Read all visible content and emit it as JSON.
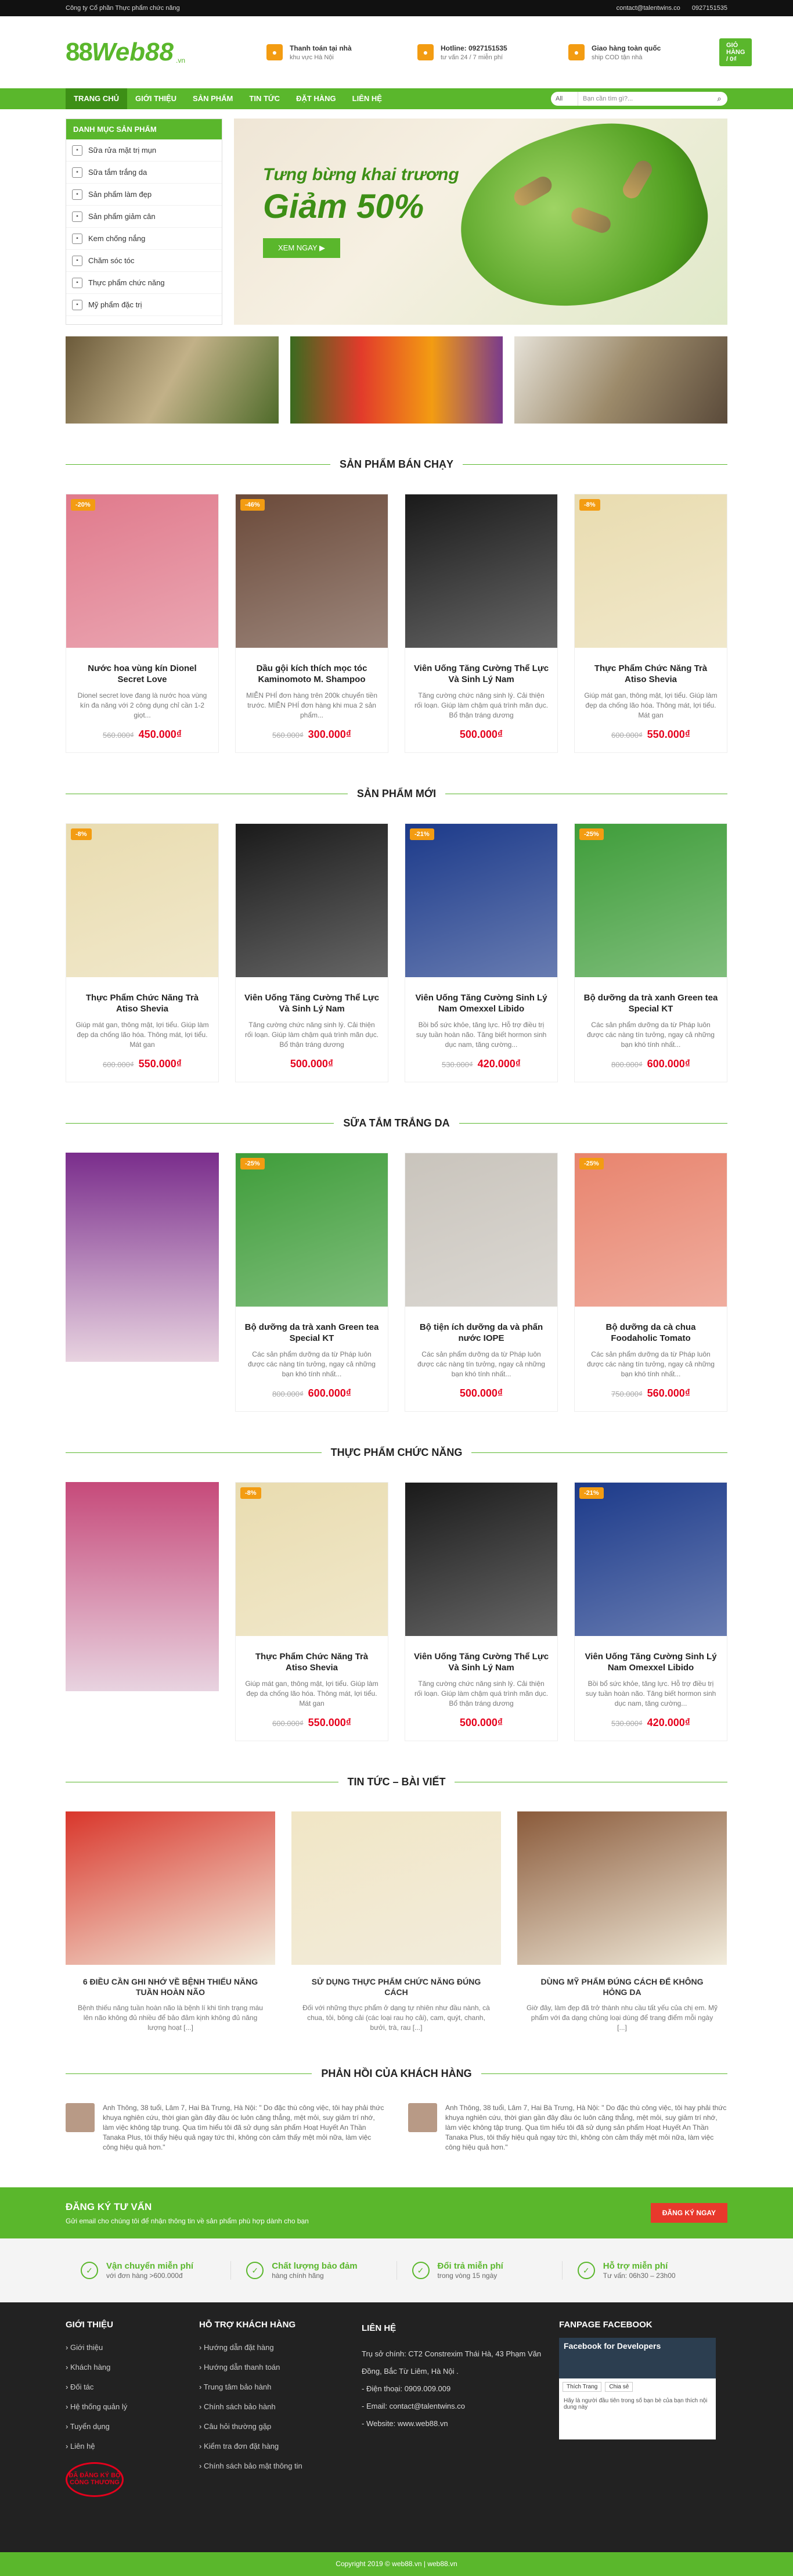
{
  "topbar": {
    "company": "Công ty Cổ phần Thực phẩm chức năng",
    "email": "contact@talentwins.co",
    "phone": "0927151535"
  },
  "header": {
    "logo": "Web88",
    "logo_vn": ".vn",
    "info": [
      {
        "title": "Thanh toán tại nhà",
        "sub": "khu vực Hà Nội",
        "icon": "wallet-icon"
      },
      {
        "title": "Hotline: 0927151535",
        "sub": "tư vấn 24 / 7 miễn phí",
        "icon": "phone-icon"
      },
      {
        "title": "Giao hàng toàn quốc",
        "sub": "ship COD tận nhà",
        "icon": "truck-icon"
      }
    ],
    "cart": "GIỎ HÀNG / 0₫"
  },
  "nav": {
    "items": [
      "TRANG CHỦ",
      "GIỚI THIỆU",
      "SẢN PHẨM",
      "TIN TỨC",
      "ĐẶT HÀNG",
      "LIÊN HỆ"
    ],
    "search_all": "All",
    "search_placeholder": "Bạn cần tìm gì?..."
  },
  "catmenu": {
    "title": "DANH MỤC SẢN PHẨM",
    "items": [
      "Sữa rửa mặt trị mụn",
      "Sữa tắm trắng da",
      "Sản phẩm làm đẹp",
      "Sản phẩm giảm cân",
      "Kem chống nắng",
      "Chăm sóc tóc",
      "Thực phẩm chức năng",
      "Mỹ phẩm đặc trị"
    ]
  },
  "slider": {
    "line1": "Tưng bừng khai trương",
    "line2": "Giảm 50%",
    "button": "XEM NGAY ▶"
  },
  "sections": {
    "best": {
      "title": "SẢN PHẨM BÁN CHẠY",
      "products": [
        {
          "discount": "-20%",
          "name": "Nước hoa vùng kín Dionel Secret Love",
          "desc": "Dionel secret love đang là nước hoa vùng kín đa năng với 2 công dụng chỉ cần 1-2 giọt...",
          "old": "560.000₫",
          "new": "450.000₫",
          "bg": "#e07a8c"
        },
        {
          "discount": "-46%",
          "name": "Dầu gội kích thích mọc tóc Kaminomoto M. Shampoo",
          "desc": "MIỄN PHÍ đơn hàng trên 200k chuyển tiền trước. MIỄN PHÍ đơn hàng khi mua 2 sản phẩm...",
          "old": "560.000₫",
          "new": "300.000₫",
          "bg": "#6b4a3a"
        },
        {
          "discount": "",
          "name": "Viên Uống Tăng Cường Thể Lực Và Sinh Lý Nam",
          "desc": "Tăng cường chức năng sinh lý. Cải thiện rối loạn. Giúp làm chậm quá trình mãn dục. Bổ thận tráng dương",
          "old": "",
          "new": "500.000₫",
          "bg": "#1a1a1a"
        },
        {
          "discount": "-8%",
          "name": "Thực Phẩm Chức Năng Trà Atiso Shevia",
          "desc": "Giúp mát gan, thông mật, lợi tiểu. Giúp làm đẹp da chống lão hóa. Thông mát, lợi tiểu. Mát gan",
          "old": "600.000₫",
          "new": "550.000₫",
          "bg": "#e9dcb0"
        }
      ]
    },
    "new": {
      "title": "SẢN PHẨM MỚI",
      "products": [
        {
          "discount": "-8%",
          "name": "Thực Phẩm Chức Năng Trà Atiso Shevia",
          "desc": "Giúp mát gan, thông mật, lợi tiểu. Giúp làm đẹp da chống lão hóa. Thông mát, lợi tiểu. Mát gan",
          "old": "600.000₫",
          "new": "550.000₫",
          "bg": "#e9dcb0"
        },
        {
          "discount": "",
          "name": "Viên Uống Tăng Cường Thể Lực Và Sinh Lý Nam",
          "desc": "Tăng cường chức năng sinh lý. Cải thiện rối loạn. Giúp làm chậm quá trình mãn dục. Bổ thận tráng dương",
          "old": "",
          "new": "500.000₫",
          "bg": "#1a1a1a"
        },
        {
          "discount": "-21%",
          "name": "Viên Uống Tăng Cường Sinh Lý Nam Omexxel Libido",
          "desc": "Bồi bổ sức khỏe, tăng lực. Hỗ trợ điều trị suy tuần hoàn não. Tăng biết hormon sinh dục nam, tăng cường...",
          "old": "530.000₫",
          "new": "420.000₫",
          "bg": "#1c3a8a"
        },
        {
          "discount": "-25%",
          "name": "Bộ dưỡng da trà xanh Green tea Special KT",
          "desc": "Các sản phẩm dưỡng da từ Pháp luôn được các nàng tín tưởng, ngay cả những bạn khó tính nhất...",
          "old": "800.000₫",
          "new": "600.000₫",
          "bg": "#3f9d3a"
        }
      ]
    },
    "bath": {
      "title": "SỮA TẮM TRẮNG DA",
      "promo_bg": "#7a2d8c",
      "products": [
        {
          "discount": "-25%",
          "name": "Bộ dưỡng da trà xanh Green tea Special KT",
          "desc": "Các sản phẩm dưỡng da từ Pháp luôn được các nàng tín tưởng, ngay cả những bạn khó tính nhất...",
          "old": "800.000₫",
          "new": "600.000₫",
          "bg": "#3f9d3a"
        },
        {
          "discount": "",
          "name": "Bộ tiện ích dưỡng da và phấn nước IOPE",
          "desc": "Các sản phẩm dưỡng da từ Pháp luôn được các nàng tín tưởng, ngay cả những bạn khó tính nhất...",
          "old": "",
          "new": "500.000₫",
          "bg": "#c9c4bc"
        },
        {
          "discount": "-25%",
          "name": "Bộ dưỡng da cà chua Foodaholic Tomato",
          "desc": "Các sản phẩm dưỡng da từ Pháp luôn được các nàng tín tưởng, ngay cả những bạn khó tính nhất...",
          "old": "750.000₫",
          "new": "560.000₫",
          "bg": "#e8846e"
        }
      ]
    },
    "func": {
      "title": "THỰC PHẨM CHỨC NĂNG",
      "promo_bg": "#c64a7a",
      "products": [
        {
          "discount": "-8%",
          "name": "Thực Phẩm Chức Năng Trà Atiso Shevia",
          "desc": "Giúp mát gan, thông mật, lợi tiểu. Giúp làm đẹp da chống lão hóa. Thông mát, lợi tiểu. Mát gan",
          "old": "600.000₫",
          "new": "550.000₫",
          "bg": "#e9dcb0"
        },
        {
          "discount": "",
          "name": "Viên Uống Tăng Cường Thể Lực Và Sinh Lý Nam",
          "desc": "Tăng cường chức năng sinh lý. Cải thiện rối loạn. Giúp làm chậm quá trình mãn dục. Bổ thận tráng dương",
          "old": "",
          "new": "500.000₫",
          "bg": "#1a1a1a"
        },
        {
          "discount": "-21%",
          "name": "Viên Uống Tăng Cường Sinh Lý Nam Omexxel Libido",
          "desc": "Bồi bổ sức khỏe, tăng lực. Hỗ trợ điều trị suy tuần hoàn não. Tăng biết hormon sinh dục nam, tăng cường...",
          "old": "530.000₫",
          "new": "420.000₫",
          "bg": "#1c3a8a"
        }
      ]
    }
  },
  "news": {
    "title": "TIN TỨC – BÀI VIẾT",
    "items": [
      {
        "title": "6 ĐIỀU CẦN GHI NHỚ VỀ BỆNH THIẾU NĂNG TUẦN HOÀN NÃO",
        "desc": "Bệnh thiếu năng tuần hoàn não là bệnh lí khi tình trạng máu lên não không đủ nhiều để bảo đảm kịnh không đủ năng lượng hoạt [...]",
        "bg": "#d9362b"
      },
      {
        "title": "SỬ DỤNG THỰC PHẨM CHỨC NĂNG ĐÚNG CÁCH",
        "desc": "Đối với những thực phẩm ở dạng tự nhiên như đầu nành, cà chua, tỏi, bông cải (các loại rau họ cải), cam, quýt, chanh, bưởi, trà, rau [...]",
        "bg": "#f1e6c5"
      },
      {
        "title": "DÙNG MỸ PHẨM ĐÚNG CÁCH ĐỂ KHÔNG HỎNG DA",
        "desc": "Giờ đây, làm đẹp đã trở thành nhu cầu tất yếu của chị em. Mỹ phẩm với đa dạng chủng loại dùng để trang điểm mỗi ngày [...]",
        "bg": "#8a5a3a"
      }
    ]
  },
  "testimonials": {
    "title": "PHẢN HỒI CỦA KHÁCH HÀNG",
    "items": [
      {
        "text": "Anh Thông, 38 tuổi, Lâm 7, Hai Bà Trưng, Hà Nội: \" Do đặc thù công việc, tôi hay phải thức khuya nghiên cứu, thời gian gần đây đầu óc luôn căng thẳng, mệt mỏi, suy giảm trí nhớ, làm việc không tập trung. Qua tìm hiểu tôi đã sử dụng sản phẩm Hoạt Huyết An Thần Tanaka Plus, tôi thấy hiệu quả ngay tức thì, không còn cảm thấy mệt mỏi nữa, làm việc công hiệu quả hơn.\""
      },
      {
        "text": "Anh Thông, 38 tuổi, Lâm 7, Hai Bà Trưng, Hà Nội: \" Do đặc thù công việc, tôi hay phải thức khuya nghiên cứu, thời gian gần đây đầu óc luôn căng thẳng, mệt mỏi, suy giảm trí nhớ, làm việc không tập trung. Qua tìm hiểu tôi đã sử dụng sản phẩm Hoạt Huyết An Thần Tanaka Plus, tôi thấy hiệu quả ngay tức thì, không còn cảm thấy mệt mỏi nữa, làm việc công hiệu quả hơn.\""
      }
    ]
  },
  "subscribe": {
    "title": "ĐĂNG KÝ TƯ VẤN",
    "desc": "Gửi email cho chúng tôi để nhận thông tin về sản phẩm phù hợp dành cho bạn",
    "button": "ĐĂNG KÝ NGAY"
  },
  "features": [
    {
      "title": "Vận chuyển miễn phí",
      "sub": "với đơn hàng >600.000đ"
    },
    {
      "title": "Chất lượng bảo đảm",
      "sub": "hàng chính hãng"
    },
    {
      "title": "Đổi trả miễn phí",
      "sub": "trong vòng 15 ngày"
    },
    {
      "title": "Hỗ trợ miễn phí",
      "sub": "Tư vấn: 06h30 – 23h00"
    }
  ],
  "footer": {
    "about": {
      "title": "GIỚI THIỆU",
      "items": [
        "Giới thiệu",
        "Khách hàng",
        "Đối tác",
        "Hệ thống quản lý",
        "Tuyển dụng",
        "Liên hệ"
      ]
    },
    "support": {
      "title": "HỖ TRỢ KHÁCH HÀNG",
      "items": [
        "Hướng dẫn đặt hàng",
        "Hướng dẫn thanh toán",
        "Trung tâm bảo hành",
        "Chính sách bảo hành",
        "Câu hỏi thường gặp",
        "Kiểm tra đơn đặt hàng",
        "Chính sách bảo mật thông tin"
      ]
    },
    "contact": {
      "title": "LIÊN HỆ",
      "lines": [
        "Trụ sở chính: CT2 Constrexim Thái Hà, 43 Phạm Văn Đồng, Bắc Từ Liêm, Hà Nội .",
        "- Điện thoại: 0909.009.009",
        "- Email: contact@talentwins.co",
        "- Website: www.web88.vn"
      ]
    },
    "fanpage": {
      "title": "FANPAGE FACEBOOK",
      "box_title": "Facebook for Developers",
      "like": "Thích Trang",
      "share": "Chia sẻ",
      "post": "Hãy là người đầu tiên trong số bạn bè của bạn thích nội dung này"
    },
    "dmca": "ĐÃ ĐĂNG KÝ BỘ CÔNG THƯƠNG"
  },
  "copyright": "Copyright 2019 © web88.vn | web88.vn"
}
